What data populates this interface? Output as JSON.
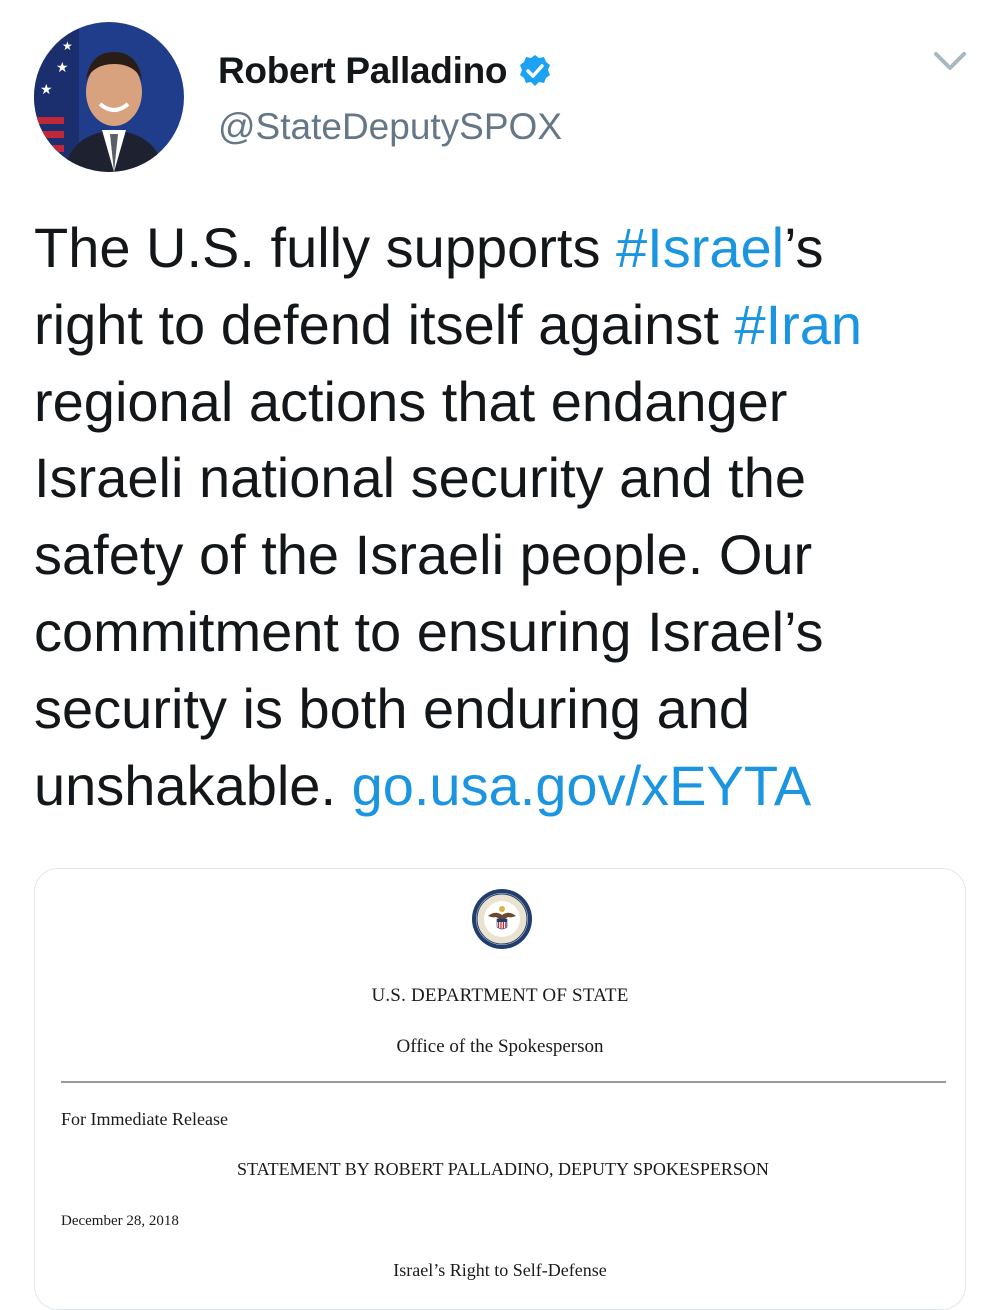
{
  "author": {
    "name": "Robert Palladino",
    "handle": "@StateDeputySPOX",
    "verified": true,
    "avatar_icon": "profile-photo"
  },
  "header": {
    "menu_icon": "chevron-down-icon"
  },
  "tweet": {
    "lines": [
      [
        {
          "text": "The U.S. fully supports ",
          "link": false
        },
        {
          "text": "#Israel",
          "link": true
        },
        {
          "text": "’s",
          "link": false
        }
      ],
      [
        {
          "text": "right to defend itself against ",
          "link": false
        },
        {
          "text": "#Iran",
          "link": true
        }
      ],
      [
        {
          "text": "regional actions that endanger",
          "link": false
        }
      ],
      [
        {
          "text": "Israeli national security and the",
          "link": false
        }
      ],
      [
        {
          "text": "safety of the Israeli people. Our",
          "link": false
        }
      ],
      [
        {
          "text": "commitment to ensuring Israel’s",
          "link": false
        }
      ],
      [
        {
          "text": "security is both enduring and",
          "link": false
        }
      ],
      [
        {
          "text": "unshakable. ",
          "link": false
        },
        {
          "text": "go.usa.gov/xEYTA",
          "link": true
        }
      ]
    ]
  },
  "card": {
    "seal_icon": "department-of-state-seal-icon",
    "department": "U.S. DEPARTMENT OF STATE",
    "office": "Office of the Spokesperson",
    "release": "For Immediate Release",
    "statement": "STATEMENT BY ROBERT PALLADINO, DEPUTY SPOKESPERSON",
    "date": "December 28, 2018",
    "subject": "Israel’s Right to Self-Defense"
  },
  "colors": {
    "link": "#1b95e0",
    "verified": "#1da1f2",
    "handle": "#657786",
    "text": "#14171a"
  }
}
